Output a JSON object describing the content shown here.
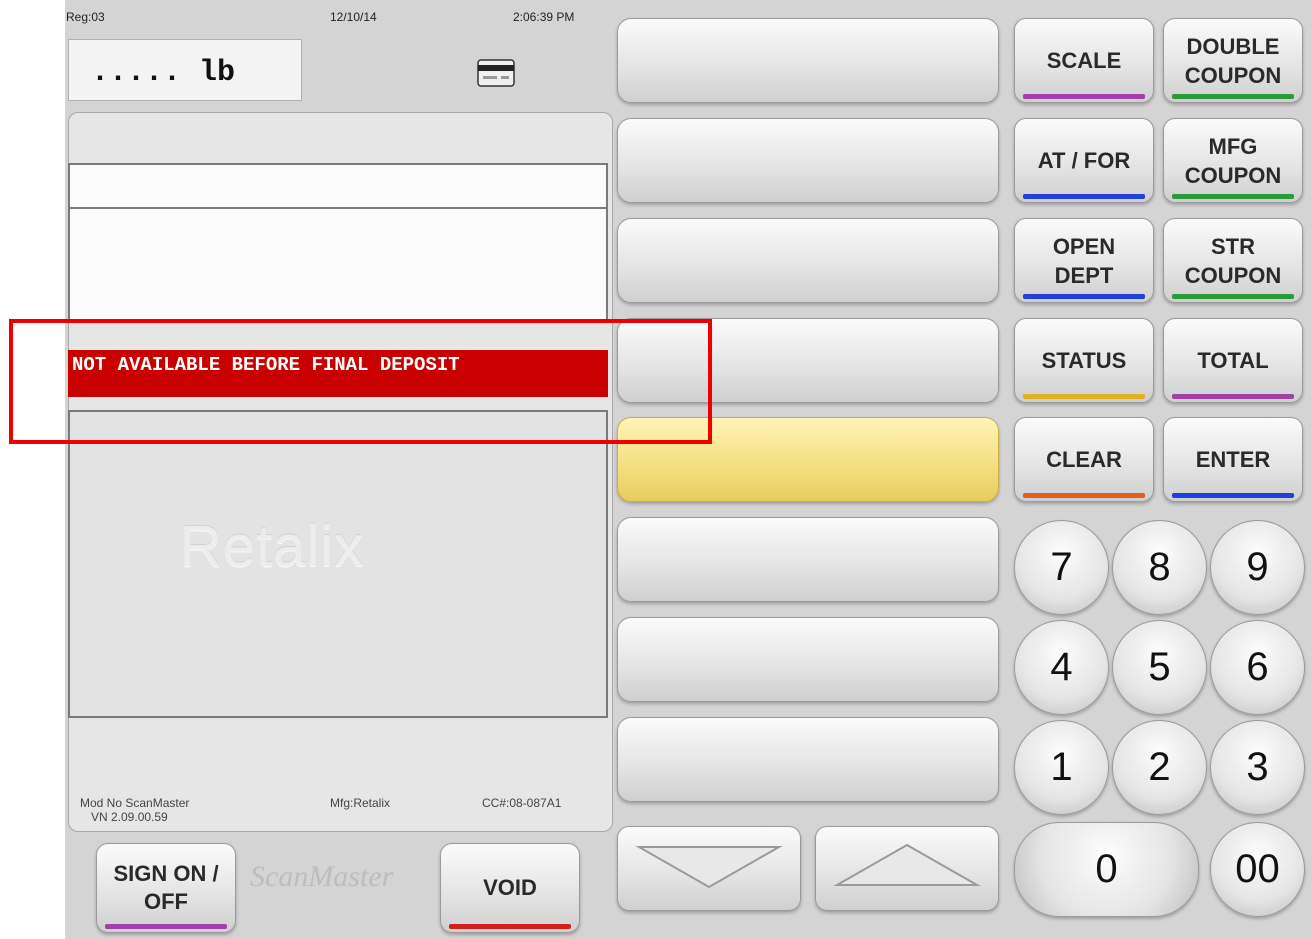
{
  "header": {
    "register": "Reg:03",
    "date": "12/10/14",
    "time": "2:06:39 PM",
    "weight": "..... lb"
  },
  "message": "NOT AVAILABLE BEFORE FINAL DEPOSIT",
  "watermark": "Retalix",
  "footer": {
    "model": "Mod No ScanMaster",
    "version": "VN 2.09.00.59",
    "manufacturer": "Mfg:Retalix",
    "certificate": "CC#:08-087A1"
  },
  "bottom_buttons": {
    "sign_on": [
      "SIGN ON /",
      "OFF"
    ],
    "logo": "ScanMaster",
    "void": "VOID"
  },
  "function_keys": [
    {
      "line1": "SCALE",
      "line2": "",
      "color": "#a040a8"
    },
    {
      "line1": "DOUBLE",
      "line2": "COUPON",
      "color": "#2a9a3a"
    },
    {
      "line1": "AT / FOR",
      "line2": "",
      "color": "#2040d8"
    },
    {
      "line1": "MFG",
      "line2": "COUPON",
      "color": "#2a9a3a"
    },
    {
      "line1": "OPEN",
      "line2": "DEPT",
      "color": "#2040d8"
    },
    {
      "line1": "STR",
      "line2": "COUPON",
      "color": "#2a9a3a"
    },
    {
      "line1": "STATUS",
      "line2": "",
      "color": "#e0b020"
    },
    {
      "line1": "TOTAL",
      "line2": "",
      "color": "#a040a8"
    },
    {
      "line1": "CLEAR",
      "line2": "",
      "color": "#e06020"
    },
    {
      "line1": "ENTER",
      "line2": "",
      "color": "#2040d8"
    }
  ],
  "keypad": [
    "7",
    "8",
    "9",
    "4",
    "5",
    "6",
    "1",
    "2",
    "3",
    "0",
    "00"
  ],
  "colors": {
    "message_bg": "#c80000",
    "highlight": "#ee0000",
    "active_slot": "#f4de7e",
    "void_bar": "#d02020",
    "sign_on_bar": "#a040a8"
  },
  "icons": {
    "card": "credit-card-icon",
    "down": "arrow-down-icon",
    "up": "arrow-up-icon"
  }
}
